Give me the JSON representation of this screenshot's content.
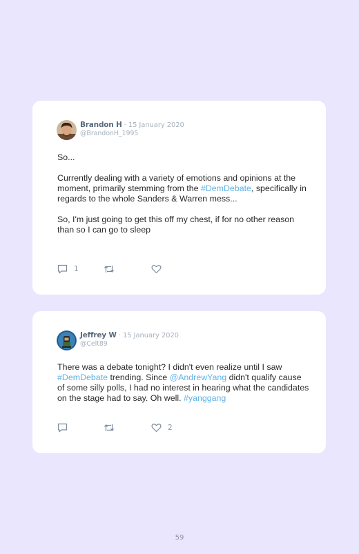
{
  "tweets": [
    {
      "name": "Brandon H",
      "date": " · 15 January 2020",
      "handle": "@BrandonH_1995",
      "paragraphs": {
        "p1": "So...",
        "p2": {
          "t1": "Currently dealing with a variety of emotions and opinions at the moment, primarily stemming from the ",
          "l1": "#DemDebate",
          "t2": ", specifically in regards to the whole Sanders & Warren mess..."
        },
        "p3": "So, I'm just going to get this off my chest, if for no other reason than so I can go to sleep"
      },
      "actions": {
        "reply": {
          "icon": "reply-icon",
          "count": "1"
        },
        "retweet": {
          "icon": "retweet-icon",
          "count": ""
        },
        "like": {
          "icon": "heart-icon",
          "count": ""
        }
      }
    },
    {
      "name": "Jeffrey W",
      "date": " · 15 January 2020",
      "handle": "@Celt89",
      "paragraphs": {
        "t1": "There was a debate tonight? I didn't even realize until I saw ",
        "l1": "#DemDebate",
        "t2": " trending. Since ",
        "l2": "@AndrewYang",
        "t3": " didn't qualify cause of some silly polls, I had no interest in hearing what the candidates on the stage had to say. Oh well. ",
        "l3": "#yanggang"
      },
      "actions": {
        "reply": {
          "icon": "reply-icon",
          "count": ""
        },
        "retweet": {
          "icon": "retweet-icon",
          "count": ""
        },
        "like": {
          "icon": "heart-icon",
          "count": "2"
        }
      }
    }
  ],
  "page_number": "59",
  "colors": {
    "background": "#e9e6fd",
    "card": "#ffffff",
    "link": "#5fb3e6",
    "icon": "#7d8a98"
  }
}
